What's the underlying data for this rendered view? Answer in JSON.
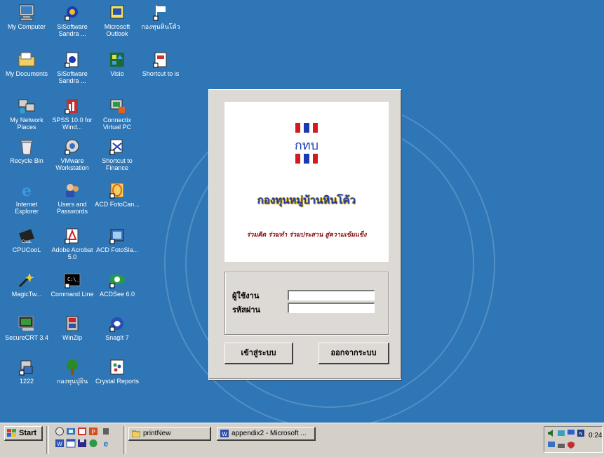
{
  "desktop": {
    "icons": [
      {
        "name": "my-computer",
        "label": "My Computer",
        "icon": "computer-icon",
        "col": 0,
        "row": 0
      },
      {
        "name": "sisoftware-sandra-1",
        "label": "SiSoftware Sandra ...",
        "icon": "sandra-icon",
        "col": 1,
        "row": 0
      },
      {
        "name": "microsoft-outlook",
        "label": "Microsoft Outlook",
        "icon": "outlook-icon",
        "col": 2,
        "row": 0
      },
      {
        "name": "fund-shortcut",
        "label": "กองทุนหินโค้ว",
        "icon": "flag-icon",
        "col": 3,
        "row": 0
      },
      {
        "name": "my-documents",
        "label": "My Documents",
        "icon": "folder-icon",
        "col": 0,
        "row": 1
      },
      {
        "name": "sisoftware-sandra-2",
        "label": "SiSoftware Sandra ...",
        "icon": "sandra-doc-icon",
        "col": 1,
        "row": 1
      },
      {
        "name": "visio",
        "label": "Visio",
        "icon": "visio-icon",
        "col": 2,
        "row": 1
      },
      {
        "name": "shortcut-to-is",
        "label": "Shortcut to is",
        "icon": "shortcut-icon",
        "col": 3,
        "row": 1
      },
      {
        "name": "my-network-places",
        "label": "My Network Places",
        "icon": "network-icon",
        "col": 0,
        "row": 2
      },
      {
        "name": "spss",
        "label": "SPSS 10.0 for Wind...",
        "icon": "spss-icon",
        "col": 1,
        "row": 2
      },
      {
        "name": "connectix-virtual-pc",
        "label": "Connectix Virtual PC",
        "icon": "virtualpc-icon",
        "col": 2,
        "row": 2
      },
      {
        "name": "recycle-bin",
        "label": "Recycle Bin",
        "icon": "recycle-bin-icon",
        "col": 0,
        "row": 3
      },
      {
        "name": "vmware",
        "label": "VMware Workstation",
        "icon": "vmware-icon",
        "col": 1,
        "row": 3
      },
      {
        "name": "shortcut-to-finance",
        "label": "Shortcut to Finance",
        "icon": "finance-icon",
        "col": 2,
        "row": 3
      },
      {
        "name": "internet-explorer",
        "label": "Internet Explorer",
        "icon": "ie-icon",
        "col": 0,
        "row": 4
      },
      {
        "name": "users-and-passwords",
        "label": "Users and Passwords",
        "icon": "users-icon",
        "col": 1,
        "row": 4
      },
      {
        "name": "acd-fotocanvas",
        "label": "ACD FotoCan...",
        "icon": "acd-canvas-icon",
        "col": 2,
        "row": 4
      },
      {
        "name": "cpucool",
        "label": "CPUCooL",
        "icon": "chip-icon",
        "col": 0,
        "row": 5
      },
      {
        "name": "adobe-acrobat",
        "label": "Adobe Acrobat 5.0",
        "icon": "acrobat-icon",
        "col": 1,
        "row": 5
      },
      {
        "name": "acd-fotoslate",
        "label": "ACD FotoSla...",
        "icon": "acd-slate-icon",
        "col": 2,
        "row": 5
      },
      {
        "name": "magictweak",
        "label": "MagicTw...",
        "icon": "magic-icon",
        "col": 0,
        "row": 6
      },
      {
        "name": "command-line",
        "label": "Command Line",
        "icon": "console-icon",
        "col": 1,
        "row": 6
      },
      {
        "name": "acdsee",
        "label": "ACDSee 6.0",
        "icon": "acdsee-icon",
        "col": 2,
        "row": 6
      },
      {
        "name": "securecrt",
        "label": "SecureCRT 3.4",
        "icon": "terminal-icon",
        "col": 0,
        "row": 7
      },
      {
        "name": "winzip",
        "label": "WinZip",
        "icon": "winzip-icon",
        "col": 1,
        "row": 7
      },
      {
        "name": "snagit",
        "label": "SnagIt 7",
        "icon": "snagit-icon",
        "col": 2,
        "row": 7
      },
      {
        "name": "item-1222",
        "label": "1222",
        "icon": "program-icon",
        "col": 0,
        "row": 8
      },
      {
        "name": "fund-tree",
        "label": "กองทุนปู่ยิน",
        "icon": "tree-icon",
        "col": 1,
        "row": 8
      },
      {
        "name": "crystal-reports",
        "label": "Crystal Reports",
        "icon": "crystal-icon",
        "col": 2,
        "row": 8
      }
    ]
  },
  "login": {
    "logo_text": "กทบ",
    "fund_name": "กองทุนหมู่บ้านหินโค้ว",
    "slogan": "ร่วมคิด ร่วมทำ ร่วมประสาน สู่ความเข้มแข็ง",
    "username_label": "ผู้ใช้งาน",
    "password_label": "รหัสผ่าน",
    "username_value": "",
    "password_value": "",
    "login_button": "เข้าสู่ระบบ",
    "exit_button": "ออกจากระบบ"
  },
  "taskbar": {
    "start_label": "Start",
    "tasks": [
      {
        "label": "printNew",
        "icon": "folder-icon"
      },
      {
        "label": "appendix2 - Microsoft ...",
        "icon": "word-icon"
      }
    ],
    "clock": "0:24"
  },
  "colors": {
    "desktop": "#2f76b6",
    "logo_blue": "#1d3bb0",
    "logo_red": "#d41a1a"
  }
}
